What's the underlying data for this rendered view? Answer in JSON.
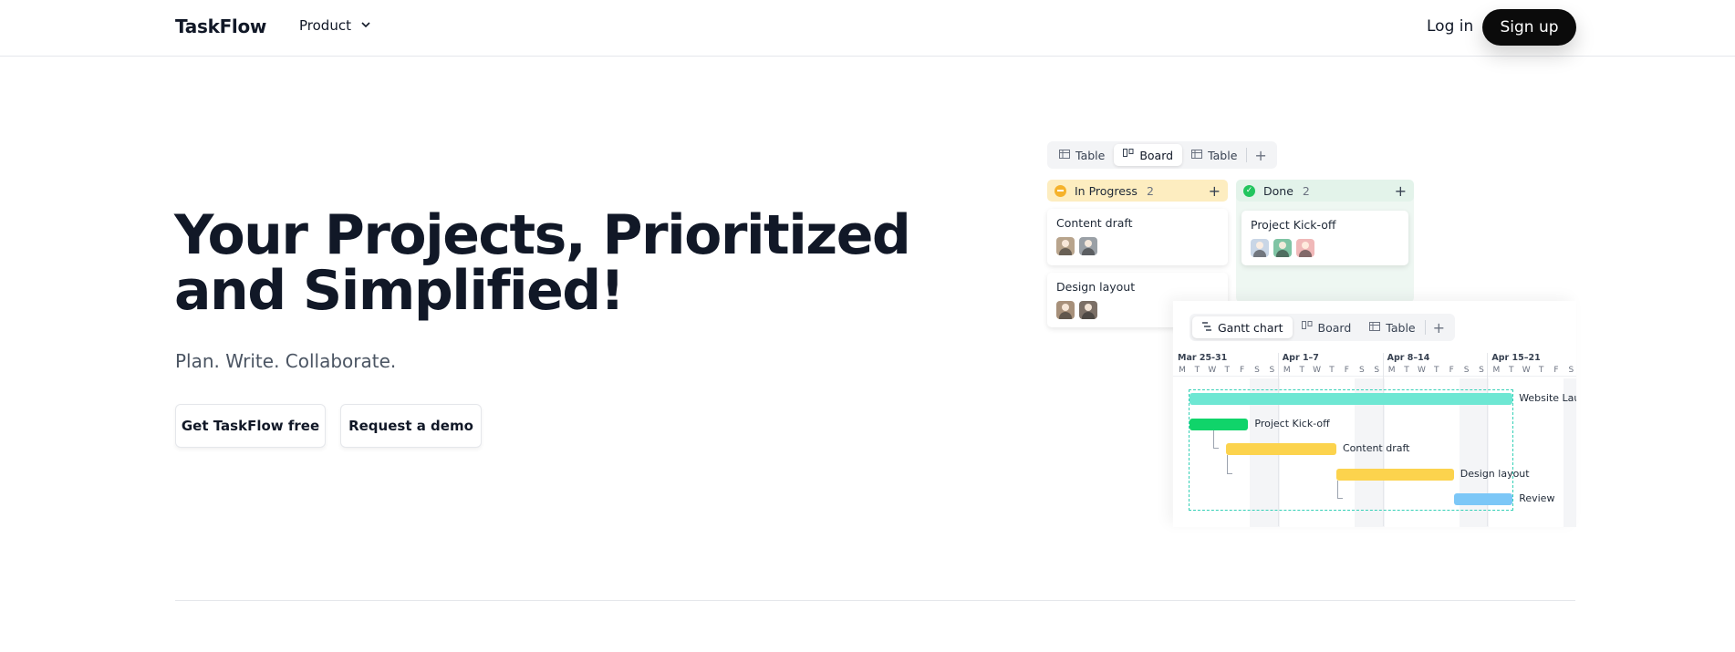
{
  "header": {
    "logo": "TaskFlow",
    "nav_product": "Product",
    "login": "Log in",
    "signup": "Sign up"
  },
  "hero": {
    "title": "Your Projects, Prioritized and Simplified!",
    "subtitle": "Plan. Write. Collaborate.",
    "primary_cta": "Get TaskFlow free",
    "secondary_cta": "Request a demo"
  },
  "board_view": {
    "tabs": [
      {
        "label": "Table",
        "icon": "table-icon",
        "active": false
      },
      {
        "label": "Board",
        "icon": "board-icon",
        "active": true
      },
      {
        "label": "Table",
        "icon": "table-icon",
        "active": false
      }
    ],
    "add_label": "+",
    "columns": [
      {
        "name": "In Progress",
        "count": "2",
        "color": "#fdedc0",
        "status_icon": "in-progress-icon",
        "cards": [
          {
            "title": "Content draft",
            "avatar_colors": [
              "#b8a48c",
              "#9aa0a6"
            ]
          },
          {
            "title": "Design layout",
            "avatar_colors": [
              "#a7907a",
              "#7b6f66"
            ]
          }
        ]
      },
      {
        "name": "Done",
        "count": "2",
        "color": "#e3f3ea",
        "status_icon": "check-circle-icon",
        "cards": [
          {
            "title": "Project Kick-off",
            "avatar_colors": [
              "#c9d6e6",
              "#7fc4a4",
              "#f0b8b8"
            ]
          }
        ]
      }
    ]
  },
  "gantt_view": {
    "tabs": [
      {
        "label": "Gantt chart",
        "icon": "gantt-icon",
        "active": true
      },
      {
        "label": "Board",
        "icon": "board-icon",
        "active": false
      },
      {
        "label": "Table",
        "icon": "table-icon",
        "active": false
      }
    ],
    "add_label": "+",
    "weeks": [
      "Mar 25-31",
      "Apr 1–7",
      "Apr 8–14",
      "Apr 15–21"
    ],
    "days": [
      "M",
      "T",
      "W",
      "T",
      "F",
      "S",
      "S"
    ],
    "tasks": [
      {
        "label": "Website Launch",
        "color": "#6ee7d3",
        "start": 0,
        "end": 22
      },
      {
        "label": "Project Kick-off",
        "color": "#10d46a",
        "start": 0,
        "end": 4
      },
      {
        "label": "Content draft",
        "color": "#fcd34d",
        "start": 2.5,
        "end": 10
      },
      {
        "label": "Design layout",
        "color": "#fcd34d",
        "start": 10,
        "end": 18
      },
      {
        "label": "Review",
        "color": "#7cc7f7",
        "start": 18,
        "end": 22
      }
    ]
  }
}
